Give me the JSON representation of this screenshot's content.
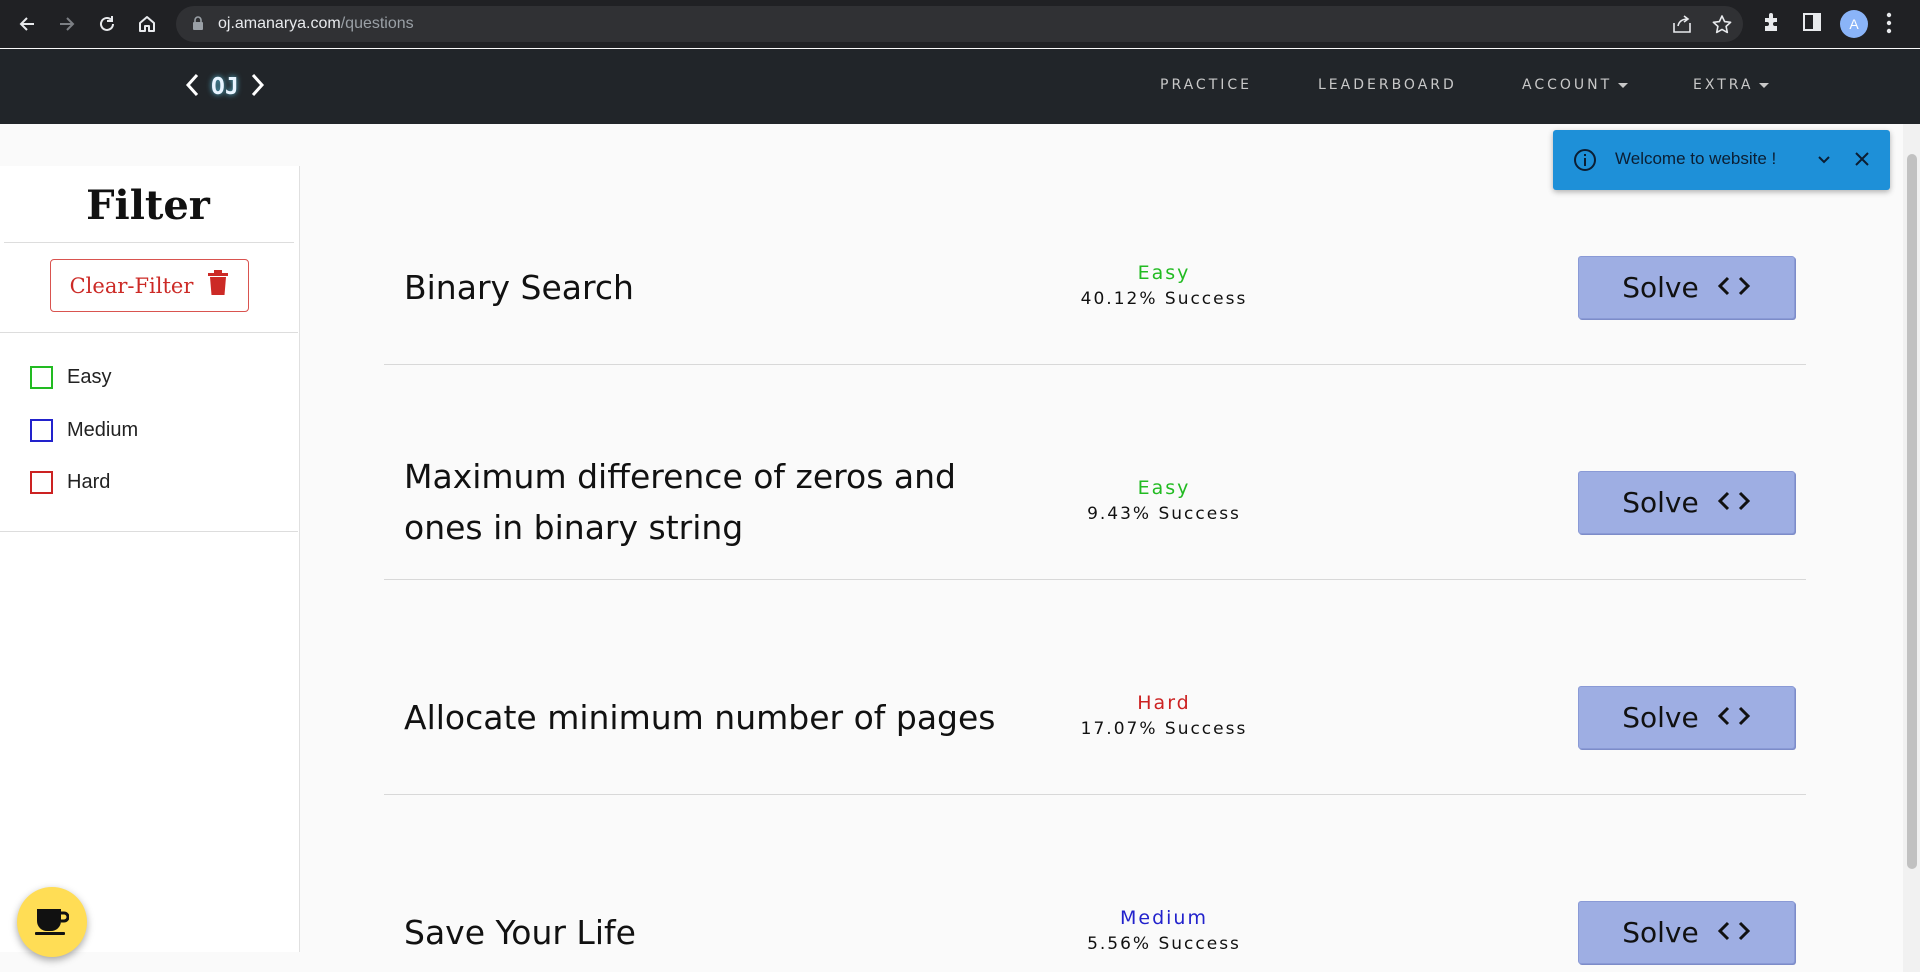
{
  "browser": {
    "url_host": "oj.amanarya.com",
    "url_path": "/questions",
    "profile_initial": "A"
  },
  "site": {
    "logo_text": "OJ",
    "nav": [
      {
        "label": "PRACTICE",
        "dropdown": false
      },
      {
        "label": "LEADERBOARD",
        "dropdown": false
      },
      {
        "label": "ACCOUNT",
        "dropdown": true
      },
      {
        "label": "EXTRA",
        "dropdown": true
      }
    ]
  },
  "sidebar": {
    "title": "Filter",
    "clear_label": "Clear-Filter",
    "filters": [
      {
        "label": "Easy",
        "color": "#22bb22",
        "checked": false
      },
      {
        "label": "Medium",
        "color": "#2222cc",
        "checked": false
      },
      {
        "label": "Hard",
        "color": "#cc2222",
        "checked": false
      }
    ]
  },
  "toast": {
    "message": "Welcome to website !"
  },
  "questions": [
    {
      "title": "Binary Search",
      "difficulty": "Easy",
      "difficulty_color": "#22bb22",
      "success": "40.12% Success",
      "action": "Solve"
    },
    {
      "title": "Maximum difference of zeros and ones in binary string",
      "difficulty": "Easy",
      "difficulty_color": "#22bb22",
      "success": "9.43% Success",
      "action": "Solve"
    },
    {
      "title": "Allocate minimum number of pages",
      "difficulty": "Hard",
      "difficulty_color": "#cc2222",
      "success": "17.07% Success",
      "action": "Solve"
    },
    {
      "title": "Save Your Life",
      "difficulty": "Medium",
      "difficulty_color": "#2222cc",
      "success": "5.56% Success",
      "action": "Solve"
    }
  ]
}
